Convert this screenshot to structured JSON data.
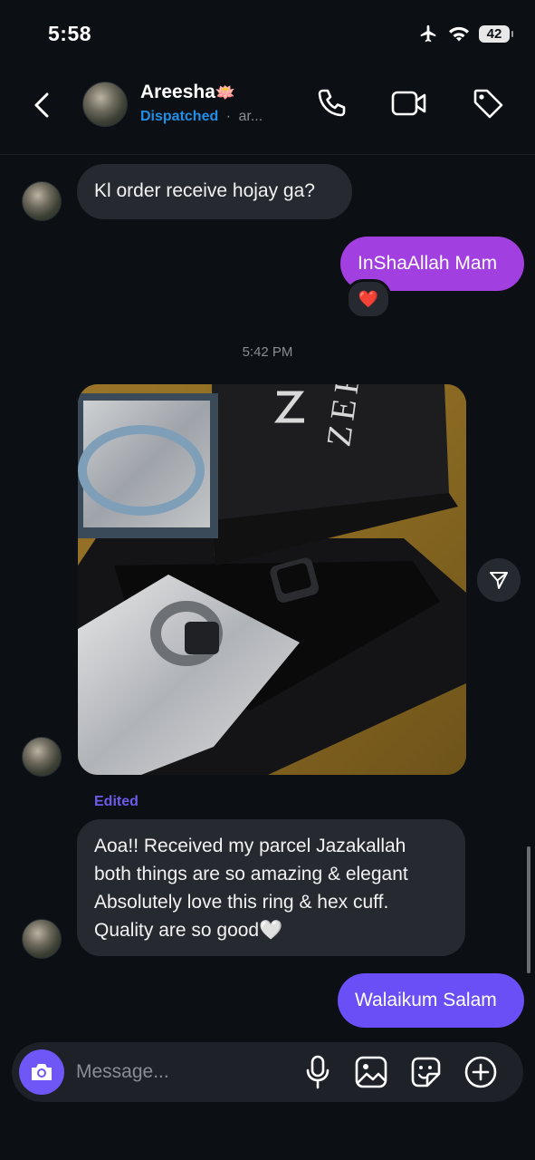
{
  "status_bar": {
    "time": "5:58",
    "battery": "42"
  },
  "header": {
    "name": "Areesha",
    "name_emoji": "🪷",
    "status_label": "Dispatched",
    "status_separator": "·",
    "status_extra": "ar..."
  },
  "messages": {
    "m1": "Kl order receive hojay ga?",
    "m2": "InShaAllah Mam",
    "m2_reaction": "❤️",
    "timestamp": "5:42 PM",
    "photo_caption_box": "ZEFI",
    "edited_label": "Edited",
    "m4": "Aoa!! Received my parcel Jazakallah both things are so amazing & elegant Absolutely love this ring & hex cuff. Quality are so good🤍",
    "m5": "Walaikum Salam"
  },
  "composer": {
    "placeholder": "Message..."
  },
  "colors": {
    "background": "#0c1014",
    "incoming_bubble": "#262a30",
    "outgoing_gradient_top": "#a23fe0",
    "outgoing_gradient_bottom": "#6a4ff7",
    "dispatched": "#1f8fe8",
    "edited": "#6c5ce7",
    "camera_button": "#6e56f7"
  },
  "icons": [
    "airplane-icon",
    "wifi-icon",
    "back-chevron-icon",
    "phone-icon",
    "video-icon",
    "tag-icon",
    "share-icon",
    "camera-icon",
    "microphone-icon",
    "image-icon",
    "sticker-icon",
    "add-icon"
  ]
}
